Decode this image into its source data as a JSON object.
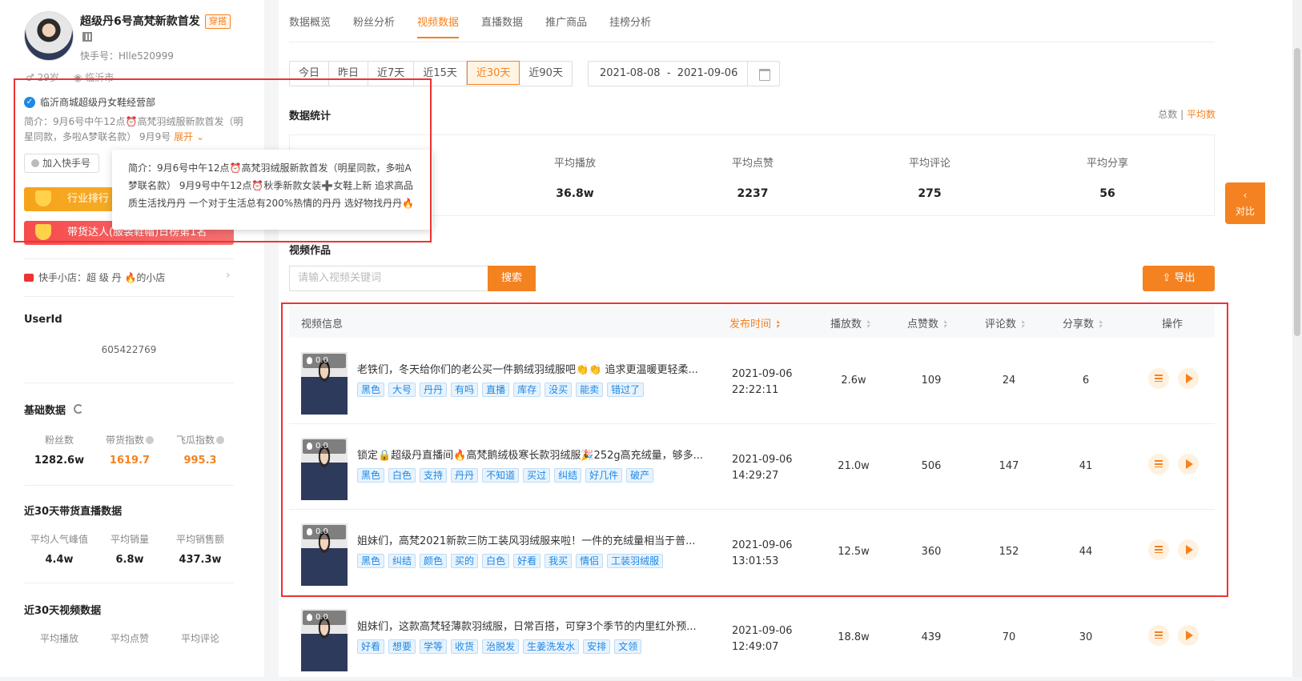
{
  "profile": {
    "name": "超级丹6号高梵新款首发",
    "category_tag": "穿搭",
    "kuaishou_id": "快手号：Hlle520999",
    "age": "29岁",
    "city": "临沂市",
    "verified": "临沂商城超级丹女鞋经营部",
    "intro_short": "简介：9月6号中午12点⏰高梵羽绒服新款首发（明星同款，多啦A梦联名款） 9月9号",
    "expand_label": "展开",
    "add_button": "加入快手号",
    "industry_rank": "行业排行",
    "goods_rank": "带货达人(服装鞋帽)日榜第1名",
    "intro_full": "简介：9月6号中午12点⏰高梵羽绒服新款首发（明星同款，多啦A梦联名款） 9月9号中午12点⏰秋季新款女装➕女鞋上新 追求高品质生活找丹丹 一个对于生活总有200%热情的丹丹 选好物找丹丹🔥",
    "shop": "快手小店：超 级 丹 🔥的小店",
    "userid_title": "UserId",
    "userid_value": "605422769"
  },
  "basic": {
    "title": "基础数据",
    "items": [
      {
        "label": "粉丝数",
        "value": "1282.6w"
      },
      {
        "label": "带货指数",
        "value": "1619.7"
      },
      {
        "label": "飞瓜指数",
        "value": "995.3"
      }
    ]
  },
  "live30": {
    "title": "近30天带货直播数据",
    "items": [
      {
        "label": "平均人气峰值",
        "value": "4.4w"
      },
      {
        "label": "平均销量",
        "value": "6.8w"
      },
      {
        "label": "平均销售额",
        "value": "437.3w"
      }
    ]
  },
  "video30": {
    "title": "近30天视频数据",
    "items": [
      {
        "label": "平均播放"
      },
      {
        "label": "平均点赞"
      },
      {
        "label": "平均评论"
      }
    ]
  },
  "tabs": [
    "数据概览",
    "粉丝分析",
    "视频数据",
    "直播数据",
    "推广商品",
    "挂榜分析"
  ],
  "ranges": [
    "今日",
    "昨日",
    "近7天",
    "近15天",
    "近30天",
    "近90天"
  ],
  "date_range": {
    "start": "2021-08-08",
    "sep": "-",
    "end": "2021-09-06"
  },
  "stats": {
    "title": "数据统计",
    "toggle_total": "总数",
    "toggle_sep": "|",
    "toggle_avg": "平均数",
    "items": [
      {
        "label": "平均播放",
        "value": "36.8w"
      },
      {
        "label": "平均点赞",
        "value": "2237"
      },
      {
        "label": "平均评论",
        "value": "275"
      },
      {
        "label": "平均分享",
        "value": "56"
      }
    ]
  },
  "compare": "对比",
  "works": {
    "title": "视频作品",
    "search_placeholder": "请输入视频关键词",
    "search_button": "搜索",
    "export_button": "导出"
  },
  "table": {
    "headers": [
      "视频信息",
      "发布时间",
      "播放数",
      "点赞数",
      "评论数",
      "分享数",
      "操作"
    ],
    "rows": [
      {
        "heat": "0.0",
        "title": "老铁们，冬天给你们的老公买一件鹅绒羽绒服吧👏👏 追求更温暖更轻柔...",
        "tags": [
          "黑色",
          "大号",
          "丹丹",
          "有吗",
          "直播",
          "库存",
          "没买",
          "能卖",
          "错过了"
        ],
        "date": "2021-09-06",
        "time": "22:22:11",
        "plays": "2.6w",
        "likes": "109",
        "comments": "24",
        "shares": "6"
      },
      {
        "heat": "0.0",
        "title": "锁定🔒超级丹直播间🔥高梵鹅绒极寒长款羽绒服🎉252g高充绒量，够多...",
        "tags": [
          "黑色",
          "白色",
          "支持",
          "丹丹",
          "不知道",
          "买过",
          "纠结",
          "好几件",
          "破产"
        ],
        "date": "2021-09-06",
        "time": "14:29:27",
        "plays": "21.0w",
        "likes": "506",
        "comments": "147",
        "shares": "41"
      },
      {
        "heat": "0.0",
        "title": "姐妹们，高梵2021新款三防工装风羽绒服来啦！一件的充绒量相当于普...",
        "tags": [
          "黑色",
          "纠结",
          "颜色",
          "买的",
          "白色",
          "好看",
          "我买",
          "情侣",
          "工装羽绒服"
        ],
        "date": "2021-09-06",
        "time": "13:01:53",
        "plays": "12.5w",
        "likes": "360",
        "comments": "152",
        "shares": "44"
      },
      {
        "heat": "0.0",
        "title": "姐妹们，这款高梵轻薄款羽绒服，日常百搭，可穿3个季节的内里红外预...",
        "tags": [
          "好看",
          "想要",
          "学等",
          "收货",
          "治脱发",
          "生姜洗发水",
          "安排",
          "文领"
        ],
        "date": "2021-09-06",
        "time": "12:49:07",
        "plays": "18.8w",
        "likes": "439",
        "comments": "70",
        "shares": "30"
      }
    ]
  }
}
